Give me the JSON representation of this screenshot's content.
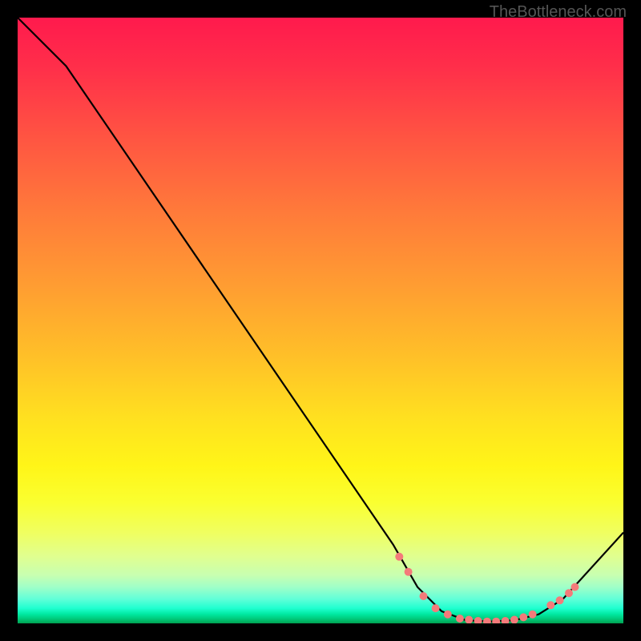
{
  "watermark": "TheBottleneck.com",
  "chart_data": {
    "type": "line",
    "title": "",
    "xlabel": "",
    "ylabel": "",
    "xlim": [
      0,
      100
    ],
    "ylim": [
      0,
      100
    ],
    "series": [
      {
        "name": "bottleneck-curve",
        "x": [
          0,
          8,
          62,
          66,
          70,
          74,
          78,
          82,
          86,
          90,
          100
        ],
        "y": [
          100,
          92,
          13,
          6,
          2,
          0.5,
          0.3,
          0.5,
          1.5,
          4,
          15
        ]
      }
    ],
    "markers": {
      "name": "highlight-dots",
      "color": "#f47a7a",
      "points": [
        {
          "x": 63,
          "y": 11
        },
        {
          "x": 64.5,
          "y": 8.5
        },
        {
          "x": 67,
          "y": 4.5
        },
        {
          "x": 69,
          "y": 2.5
        },
        {
          "x": 71,
          "y": 1.5
        },
        {
          "x": 73,
          "y": 0.8
        },
        {
          "x": 74.5,
          "y": 0.6
        },
        {
          "x": 76,
          "y": 0.4
        },
        {
          "x": 77.5,
          "y": 0.3
        },
        {
          "x": 79,
          "y": 0.3
        },
        {
          "x": 80.5,
          "y": 0.4
        },
        {
          "x": 82,
          "y": 0.6
        },
        {
          "x": 83.5,
          "y": 1.0
        },
        {
          "x": 85,
          "y": 1.5
        },
        {
          "x": 88,
          "y": 3.0
        },
        {
          "x": 89.5,
          "y": 3.8
        },
        {
          "x": 91,
          "y": 5.0
        },
        {
          "x": 92,
          "y": 6.0
        }
      ]
    },
    "background_gradient": {
      "top": "#ff1a4d",
      "mid": "#ffe020",
      "bottom": "#00a050"
    }
  }
}
